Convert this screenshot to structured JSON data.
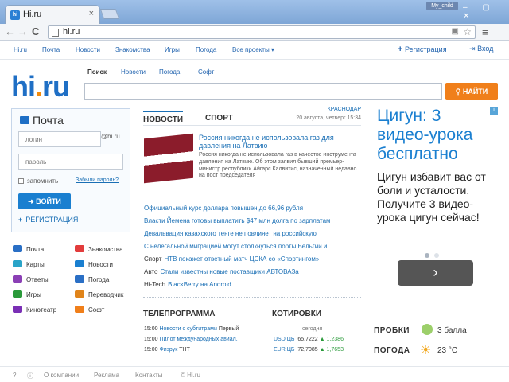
{
  "browser": {
    "tab_title": "Hi.ru",
    "tab_close": "×",
    "favicon_text": "hi",
    "profile": "My_child",
    "window_controls": "– ▢ ✕",
    "url": "hi.ru",
    "back": "←",
    "forward": "→",
    "reload": "C",
    "bookmark_star": "☆",
    "menu": "≡"
  },
  "topnav": {
    "items": [
      "Hi.ru",
      "Почта",
      "Новости",
      "Знакомства",
      "Игры",
      "Погода",
      "Все проекты ▾"
    ],
    "register": "Регистрация",
    "login": "Вход"
  },
  "logo": {
    "main": "hi",
    "dot": ".",
    "tld": "ru"
  },
  "search": {
    "tabs": [
      "Поиск",
      "Новости",
      "Погода",
      "Софт"
    ],
    "button": "НАЙТИ",
    "button_icon": "search-icon"
  },
  "mail": {
    "title": "Почта",
    "login_placeholder": "логин",
    "domain": "@hi.ru",
    "password_placeholder": "пароль",
    "remember": "запомнить",
    "forgot": "Забыли пароль?",
    "login_button": "ВОЙТИ",
    "register": "РЕГИСТРАЦИЯ"
  },
  "services": [
    {
      "label": "Почта",
      "icon": "mail-icon",
      "color": "#2a6fc5"
    },
    {
      "label": "Знакомства",
      "icon": "hearts-icon",
      "color": "#e23c3c"
    },
    {
      "label": "Карты",
      "icon": "map-icon",
      "color": "#2aa4c8"
    },
    {
      "label": "Новости",
      "icon": "news-icon",
      "color": "#1a7fd0"
    },
    {
      "label": "Ответы",
      "icon": "answers-icon",
      "color": "#8b3fb5"
    },
    {
      "label": "Погода",
      "icon": "cloud-icon",
      "color": "#2a6fc5"
    },
    {
      "label": "Игры",
      "icon": "gamepad-icon",
      "color": "#2a9a3a"
    },
    {
      "label": "Переводчик",
      "icon": "translate-icon",
      "color": "#e0841a"
    },
    {
      "label": "Кинотеатр",
      "icon": "film-icon",
      "color": "#7a2fb5"
    },
    {
      "label": "Софт",
      "icon": "star-icon",
      "color": "#f07f1a"
    }
  ],
  "news": {
    "tab_news": "НОВОСТИ",
    "tab_sport": "СПОРТ",
    "city": "КРАСНОДАР",
    "date": "20 августа, четверг 15:34",
    "main_title": "Россия никогда не использовала газ для давления на Латвию",
    "main_text": "Россия никогда не использовала газ в качестве инструмента давления на Латвию. Об этом заявил бывший премьер-министр республики Айгарс Калвитис, назначенный недавно на пост председателя",
    "list": [
      {
        "prefix": "",
        "text": "Официальный курс доллара повышен до 66,96 рубля"
      },
      {
        "prefix": "",
        "text": "Власти Йемена готовы выплатить $47 млн долга по зарплатам"
      },
      {
        "prefix": "",
        "text": "Девальвация казахского тенге не повлияет на российскую"
      },
      {
        "prefix": "",
        "text": "С нелегальной миграцией могут столкнуться порты Бельгии и"
      },
      {
        "prefix": "Спорт",
        "text": "НТВ покажет ответный матч ЦСКА со «Спортингом»"
      },
      {
        "prefix": "Авто",
        "text": "Стали известны новые поставщики АВТОВАЗа"
      },
      {
        "prefix": "Hi-Tech",
        "text": "BlackBerry на Android"
      }
    ]
  },
  "tv": {
    "title": "ТЕЛЕПРОГРАММА",
    "rows": [
      {
        "time": "15:00",
        "show": "Новости с субтитрами",
        "channel": "Первый"
      },
      {
        "time": "15:00",
        "show": "Пилот международных авиал.",
        "channel": ""
      },
      {
        "time": "15:00",
        "show": "Физрук",
        "channel": "ТНТ"
      }
    ]
  },
  "quotes": {
    "title": "КОТИРОВКИ",
    "today": "сегодня",
    "rows": [
      {
        "name": "USD ЦБ",
        "value": "65,7222",
        "change": "1,2386"
      },
      {
        "name": "EUR ЦБ",
        "value": "72,7085",
        "change": "1,7653"
      }
    ]
  },
  "ad": {
    "headline": "Цигун: 3 видео-урока бесплатно",
    "text": "Цигун избавит вас от боли и усталости. Получите 3 видео-урока цигун сейчас!",
    "info": "i",
    "next": "›"
  },
  "traffic": {
    "label": "ПРОБКИ",
    "value": "3 балла",
    "icon": "traffic-icon"
  },
  "weather": {
    "label": "ПОГОДА",
    "value": "23 °C",
    "icon": "sun-icon"
  },
  "footer": [
    "О компании",
    "Реклама",
    "Контакты",
    "© Hi.ru"
  ]
}
